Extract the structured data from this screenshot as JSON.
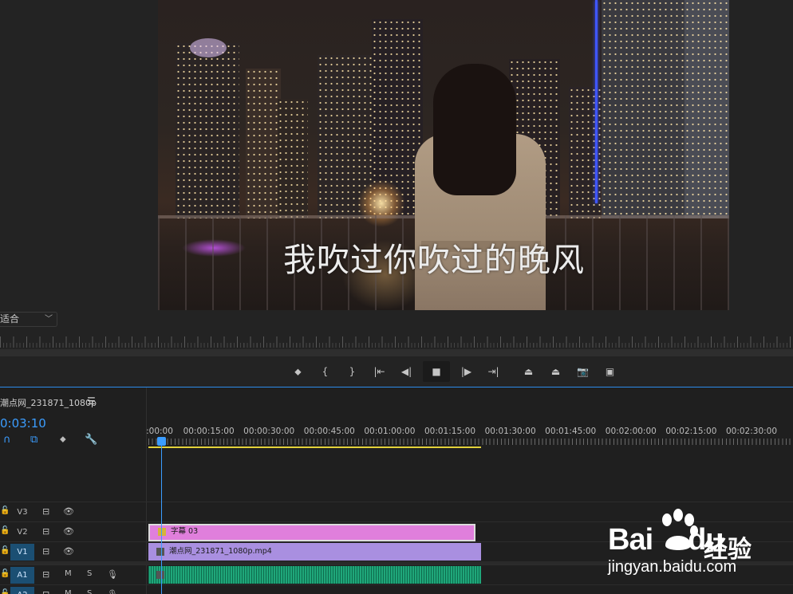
{
  "monitor": {
    "subtitle_text": "我吹过你吹过的晚风",
    "fit_select": "适合",
    "transport_buttons": [
      {
        "name": "add-marker-button",
        "glyph": "⬥"
      },
      {
        "name": "mark-in-button",
        "glyph": "{"
      },
      {
        "name": "mark-out-button",
        "glyph": "}"
      },
      {
        "name": "go-to-in-button",
        "glyph": "|⇤"
      },
      {
        "name": "step-back-button",
        "glyph": "◀|"
      },
      {
        "name": "play-stop-button",
        "glyph": "■"
      },
      {
        "name": "step-forward-button",
        "glyph": "|▶"
      },
      {
        "name": "go-to-out-button",
        "glyph": "⇥|"
      },
      {
        "name": "lift-button",
        "glyph": "⏏"
      },
      {
        "name": "extract-button",
        "glyph": "⏏"
      },
      {
        "name": "export-frame-button",
        "glyph": "📷"
      },
      {
        "name": "compare-button",
        "glyph": "▣"
      }
    ]
  },
  "timeline": {
    "sequence_name": "潮点网_231871_1080p",
    "menu_icon": "☰",
    "timecode": "0:03:10",
    "tools": [
      {
        "name": "snap-icon",
        "glyph": "∩"
      },
      {
        "name": "linked-selection-icon",
        "glyph": "⧉"
      },
      {
        "name": "add-marker-icon",
        "glyph": "⬥"
      },
      {
        "name": "wrench-icon",
        "glyph": "🔧"
      }
    ],
    "ruler_labels": [
      ":00:00",
      "00:00:15:00",
      "00:00:30:00",
      "00:00:45:00",
      "00:01:00:00",
      "00:01:15:00",
      "00:01:30:00",
      "00:01:45:00",
      "00:02:00:00",
      "00:02:15:00",
      "00:02:30:00"
    ],
    "tracks": [
      {
        "name": "V3",
        "target": false
      },
      {
        "name": "V2",
        "target": false
      },
      {
        "name": "V1",
        "target": true
      },
      {
        "name": "A1",
        "target": true
      },
      {
        "name": "A2",
        "target": true
      }
    ],
    "mute_label": "M",
    "solo_label": "S",
    "clips": {
      "subtitle": "字幕 03",
      "video": "潮点网_231871_1080p.mp4"
    }
  },
  "watermark": {
    "brand_left": "Bai",
    "brand_right": "du",
    "brand_cn": "经验",
    "url": "jingyan.baidu.com"
  },
  "colors": {
    "accent": "#3b9dff",
    "subtitle_clip": "#e07fdc",
    "video_clip": "#a98fe0",
    "audio_clip": "#1fa77a",
    "work_area": "#e3d23a"
  }
}
